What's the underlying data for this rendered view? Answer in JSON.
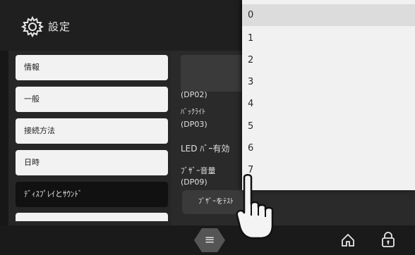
{
  "header": {
    "title": "設定",
    "icon": "gear-icon"
  },
  "sidebar": {
    "items": [
      {
        "label": "情報"
      },
      {
        "label": "一般"
      },
      {
        "label": "接続方法"
      },
      {
        "label": "日時"
      },
      {
        "label": "ﾃﾞｨｽﾌﾟﾚｲとｻｳﾝﾄﾞ",
        "selected": true
      }
    ]
  },
  "settings": {
    "dp02": "(DP02)",
    "backlight": "ﾊﾞｯｸﾗｲﾄ",
    "dp03": "(DP03)",
    "led_bar": "LED ﾊﾞｰ有効",
    "buzzer_volume": "ﾌﾞｻﾞｰ音量",
    "dp09": "(DP09)",
    "buzzer_test_button": "ﾌﾞｻﾞｰをﾃｽﾄ"
  },
  "dropdown": {
    "options": [
      "0",
      "1",
      "2",
      "3",
      "4",
      "5",
      "6",
      "7"
    ],
    "selected": "0"
  },
  "bottom_bar": {
    "menu_icon": "hamburger-icon",
    "menu_glyph": "≡",
    "home_icon": "home-icon",
    "lock_icon": "lock-icon"
  },
  "overlay": {
    "pointer": "pointing-hand-icon"
  }
}
